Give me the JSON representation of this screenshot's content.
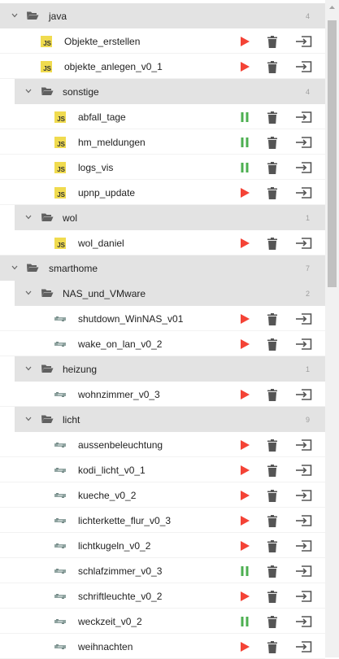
{
  "tree": [
    {
      "kind": "folder",
      "level": 0,
      "label": "java",
      "count": "4",
      "name": "folder-java"
    },
    {
      "kind": "script",
      "level": 1,
      "label": "Objekte_erstellen",
      "type": "js",
      "state": "stopped",
      "name": "script-objekte-erstellen"
    },
    {
      "kind": "script",
      "level": 1,
      "label": "objekte_anlegen_v0_1",
      "type": "js",
      "state": "stopped",
      "name": "script-objekte-anlegen"
    },
    {
      "kind": "folder",
      "level": 1,
      "label": "sonstige",
      "count": "4",
      "name": "folder-sonstige"
    },
    {
      "kind": "script",
      "level": 2,
      "label": "abfall_tage",
      "type": "js",
      "state": "running",
      "name": "script-abfall-tage"
    },
    {
      "kind": "script",
      "level": 2,
      "label": "hm_meldungen",
      "type": "js",
      "state": "running",
      "name": "script-hm-meldungen"
    },
    {
      "kind": "script",
      "level": 2,
      "label": "logs_vis",
      "type": "js",
      "state": "running",
      "name": "script-logs-vis"
    },
    {
      "kind": "script",
      "level": 2,
      "label": "upnp_update",
      "type": "js",
      "state": "stopped",
      "name": "script-upnp-update"
    },
    {
      "kind": "folder",
      "level": 1,
      "label": "wol",
      "count": "1",
      "name": "folder-wol"
    },
    {
      "kind": "script",
      "level": 2,
      "label": "wol_daniel",
      "type": "js",
      "state": "stopped",
      "name": "script-wol-daniel"
    },
    {
      "kind": "folder",
      "level": 0,
      "label": "smarthome",
      "count": "7",
      "name": "folder-smarthome"
    },
    {
      "kind": "folder",
      "level": 1,
      "label": "NAS_und_VMware",
      "count": "2",
      "name": "folder-nas-und-vmware"
    },
    {
      "kind": "script",
      "level": 2,
      "label": "shutdown_WinNAS_v01",
      "type": "blockly",
      "state": "stopped",
      "name": "script-shutdown-winnas"
    },
    {
      "kind": "script",
      "level": 2,
      "label": "wake_on_lan_v0_2",
      "type": "blockly",
      "state": "stopped",
      "name": "script-wake-on-lan"
    },
    {
      "kind": "folder",
      "level": 1,
      "label": "heizung",
      "count": "1",
      "name": "folder-heizung"
    },
    {
      "kind": "script",
      "level": 2,
      "label": "wohnzimmer_v0_3",
      "type": "blockly",
      "state": "stopped",
      "name": "script-wohnzimmer"
    },
    {
      "kind": "folder",
      "level": 1,
      "label": "licht",
      "count": "9",
      "name": "folder-licht"
    },
    {
      "kind": "script",
      "level": 2,
      "label": "aussenbeleuchtung",
      "type": "blockly",
      "state": "stopped",
      "name": "script-aussenbeleuchtung"
    },
    {
      "kind": "script",
      "level": 2,
      "label": "kodi_licht_v0_1",
      "type": "blockly",
      "state": "stopped",
      "name": "script-kodi-licht"
    },
    {
      "kind": "script",
      "level": 2,
      "label": "kueche_v0_2",
      "type": "blockly",
      "state": "stopped",
      "name": "script-kueche"
    },
    {
      "kind": "script",
      "level": 2,
      "label": "lichterkette_flur_v0_3",
      "type": "blockly",
      "state": "stopped",
      "name": "script-lichterkette-flur"
    },
    {
      "kind": "script",
      "level": 2,
      "label": "lichtkugeln_v0_2",
      "type": "blockly",
      "state": "stopped",
      "name": "script-lichtkugeln"
    },
    {
      "kind": "script",
      "level": 2,
      "label": "schlafzimmer_v0_3",
      "type": "blockly",
      "state": "running",
      "name": "script-schlafzimmer"
    },
    {
      "kind": "script",
      "level": 2,
      "label": "schriftleuchte_v0_2",
      "type": "blockly",
      "state": "stopped",
      "name": "script-schriftleuchte"
    },
    {
      "kind": "script",
      "level": 2,
      "label": "weckzeit_v0_2",
      "type": "blockly",
      "state": "running",
      "name": "script-weckzeit"
    },
    {
      "kind": "script",
      "level": 2,
      "label": "weihnachten",
      "type": "blockly",
      "state": "stopped",
      "name": "script-weihnachten"
    }
  ],
  "icons": {
    "folder": "folder-open-icon",
    "chevron": "chevron-down-icon",
    "js": "javascript-icon",
    "js_text": "JS",
    "blockly": "blockly-icon",
    "run": "play-icon",
    "pause": "pause-icon",
    "delete": "trash-icon",
    "export": "export-icon"
  },
  "colors": {
    "folder_row": "#e3e3e3",
    "play": "#f44336",
    "pause": "#4caf50",
    "icon_gray": "#555555",
    "count": "#9e9e9e",
    "js_yellow": "#f0db4f"
  }
}
